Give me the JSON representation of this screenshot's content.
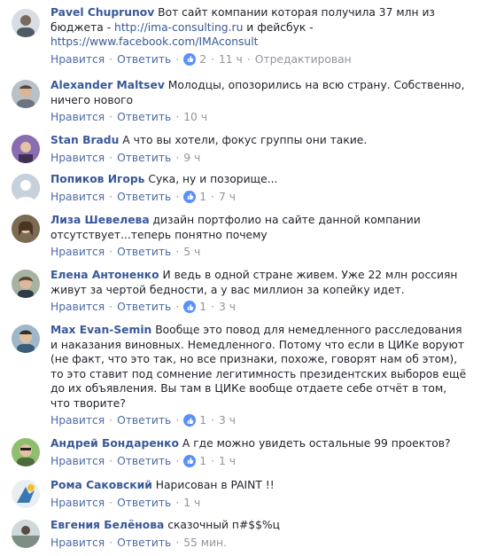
{
  "actions": {
    "like": "Нравится",
    "reply": "Ответить",
    "separator": "·"
  },
  "colors": {
    "author": "#385898",
    "action": "#4b6aa6",
    "meta": "#90949c",
    "like_badge": "#5890ff"
  },
  "comments": [
    {
      "author": "Pavel Chuprunov",
      "text_before": " Вот сайт компании которая получила 37 млн из бюджета - ",
      "link1": "http://ima-consulting.ru",
      "text_mid": " и фейсбук - ",
      "link2": "https://www.facebook.com/IMAconsult",
      "likes": "2",
      "time": "11 ч",
      "edited": "Отредактирован"
    },
    {
      "author": "Alexander Maltsev",
      "text": " Молодцы, опозорились на всю страну. Собственно, ничего нового",
      "time": "10 ч"
    },
    {
      "author": "Stan Bradu",
      "text": " А что вы хотели, фокус группы они такие.",
      "time": "9 ч"
    },
    {
      "author": "Попиков Игорь",
      "text": " Сука, ну и позорище...",
      "likes": "1",
      "time": "7 ч"
    },
    {
      "author": "Лиза Шевелева",
      "text": " дизайн портфолио на сайте данной компании отсутствует...теперь понятно почему",
      "time": "5 ч"
    },
    {
      "author": "Елена Антоненко",
      "text": " И ведь в одной стране живем. Уже 22 млн россиян живут за чертой бедности, а у вас миллион за копейку идет.",
      "likes": "1",
      "time": "3 ч"
    },
    {
      "author": "Max Evan-Semin",
      "text": " Вообще это повод для немедленного расследования и наказания виновных. Немедленного. Потому что если в ЦИКе воруют (не факт, что это так, но все признаки, похоже, говорят нам об этом), то это ставит под сомнение легитимность президентских выборов ещё до их объявления. Вы там в ЦИКе вообще отдаете себе отчёт в том, что творите?",
      "likes": "1",
      "time": "3 ч"
    },
    {
      "author": "Андрей Бондаренко",
      "text": " А где можно увидеть остальные 99 проектов?",
      "likes": "1",
      "time": "1 ч"
    },
    {
      "author": "Рома Саковский",
      "text": " Нарисован в PAINT !!",
      "time": "1 ч"
    },
    {
      "author": "Евгения Белёнова",
      "text": " сказочный п#$$%ц",
      "time": "55 мин."
    }
  ]
}
